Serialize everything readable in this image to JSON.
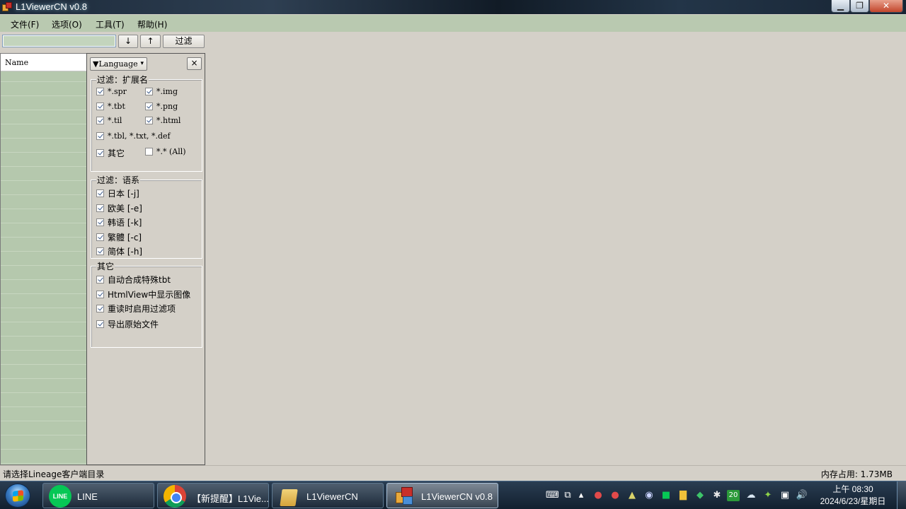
{
  "window": {
    "title": "L1ViewerCN v0.8",
    "min_glyph": "▁",
    "max_glyph": "❐",
    "close_glyph": "✕"
  },
  "menu": [
    "文件(F)",
    "选项(O)",
    "工具(T)",
    "帮助(H)"
  ],
  "toolbar": {
    "search_value": "",
    "down_label": "↓",
    "up_label": "↑",
    "filter_label": "过滤"
  },
  "list": {
    "header": "Name"
  },
  "filter_panel": {
    "language_label": "▼Language",
    "caret": "▾",
    "close_label": "×",
    "ext_group": {
      "title": "过滤：扩展名",
      "items": [
        {
          "label": "*.spr",
          "checked": true
        },
        {
          "label": "*.img",
          "checked": true
        },
        {
          "label": "*.tbt",
          "checked": true
        },
        {
          "label": "*.png",
          "checked": true
        },
        {
          "label": "*.til",
          "checked": true
        },
        {
          "label": "*.html",
          "checked": true
        },
        {
          "label": "*.tbl, *.txt, *.def",
          "checked": true
        },
        {
          "label": "其它",
          "checked": true
        },
        {
          "label": "*.* (All)",
          "checked": false
        }
      ]
    },
    "lang_group": {
      "title": "过滤：语系",
      "items": [
        {
          "label": "日本 [-j]",
          "checked": true
        },
        {
          "label": "欧美 [-e]",
          "checked": true
        },
        {
          "label": "韩语 [-k]",
          "checked": true
        },
        {
          "label": "繁體 [-c]",
          "checked": true
        },
        {
          "label": "简体 [-h]",
          "checked": true
        }
      ]
    },
    "other_group": {
      "title": "其它",
      "items": [
        {
          "label": "自动合成特殊tbt",
          "checked": true
        },
        {
          "label": "HtmlView中显示图像",
          "checked": true
        },
        {
          "label": "重读时启用过滤项",
          "checked": true
        },
        {
          "label": "导出原始文件",
          "checked": true
        }
      ]
    }
  },
  "statusbar": {
    "left": "请选择Lineage客户端目录",
    "right": "内存占用: 1.73MB"
  },
  "taskbar": {
    "line_icon_text": "LINE",
    "tasks": [
      {
        "label": "LINE"
      },
      {
        "label": "【新提醒】L1Vie..."
      },
      {
        "label": "L1ViewerCN"
      },
      {
        "label": "L1ViewerCN v0.8"
      }
    ],
    "tray": {
      "keyboard": "⌨",
      "display": "⧉",
      "chevron": "▴",
      "badge": "20",
      "speaker": "🔊",
      "network": "▣"
    },
    "clock_time": "上午 08:30",
    "clock_date": "2024/6/23/星期日"
  },
  "colors": {
    "menubar": "#b9c9b0",
    "list_row": "#b5c8ad",
    "window_bg": "#d4d0c8",
    "taskbar": "#1d2f42"
  }
}
